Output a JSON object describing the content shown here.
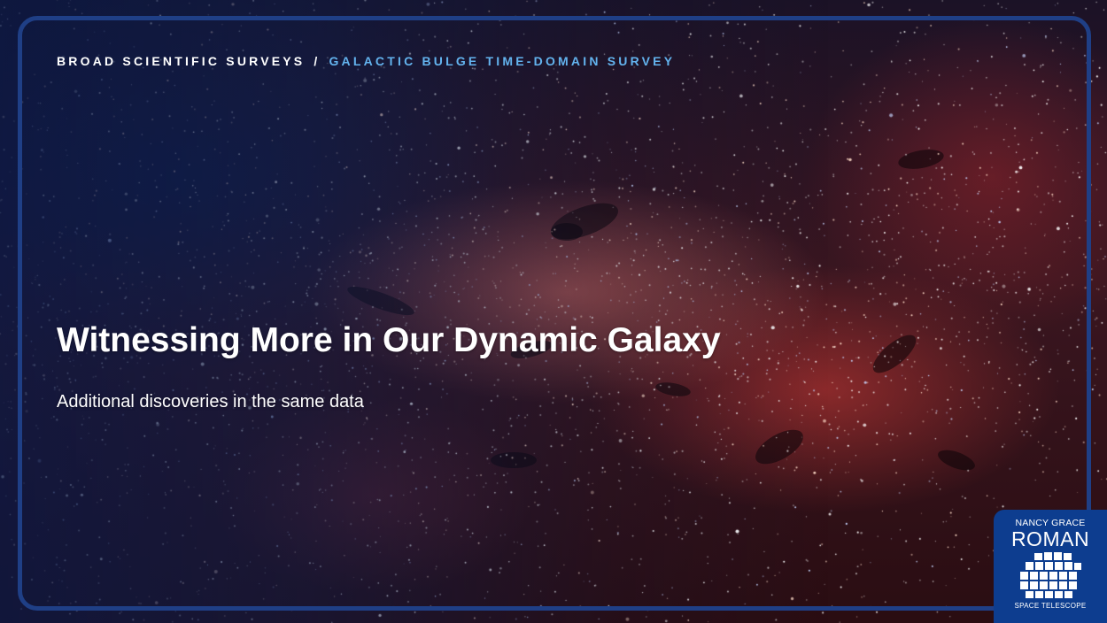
{
  "breadcrumb": {
    "section": "BROAD SCIENTIFIC SURVEYS",
    "separator": "/",
    "current": "GALACTIC BULGE TIME-DOMAIN SURVEY"
  },
  "slide": {
    "title": "Witnessing More in Our Dynamic Galaxy",
    "subtitle": "Additional discoveries in the same data"
  },
  "logo": {
    "top_text": "NANCY GRACE",
    "name": "ROMAN",
    "bottom_text": "SPACE TELESCOPE",
    "icon": "roman-telescope-mirror-icon"
  },
  "colors": {
    "frame": "#1f3f86",
    "breadcrumb_current": "#63b3ee",
    "logo_background": "#0d3d8f"
  }
}
